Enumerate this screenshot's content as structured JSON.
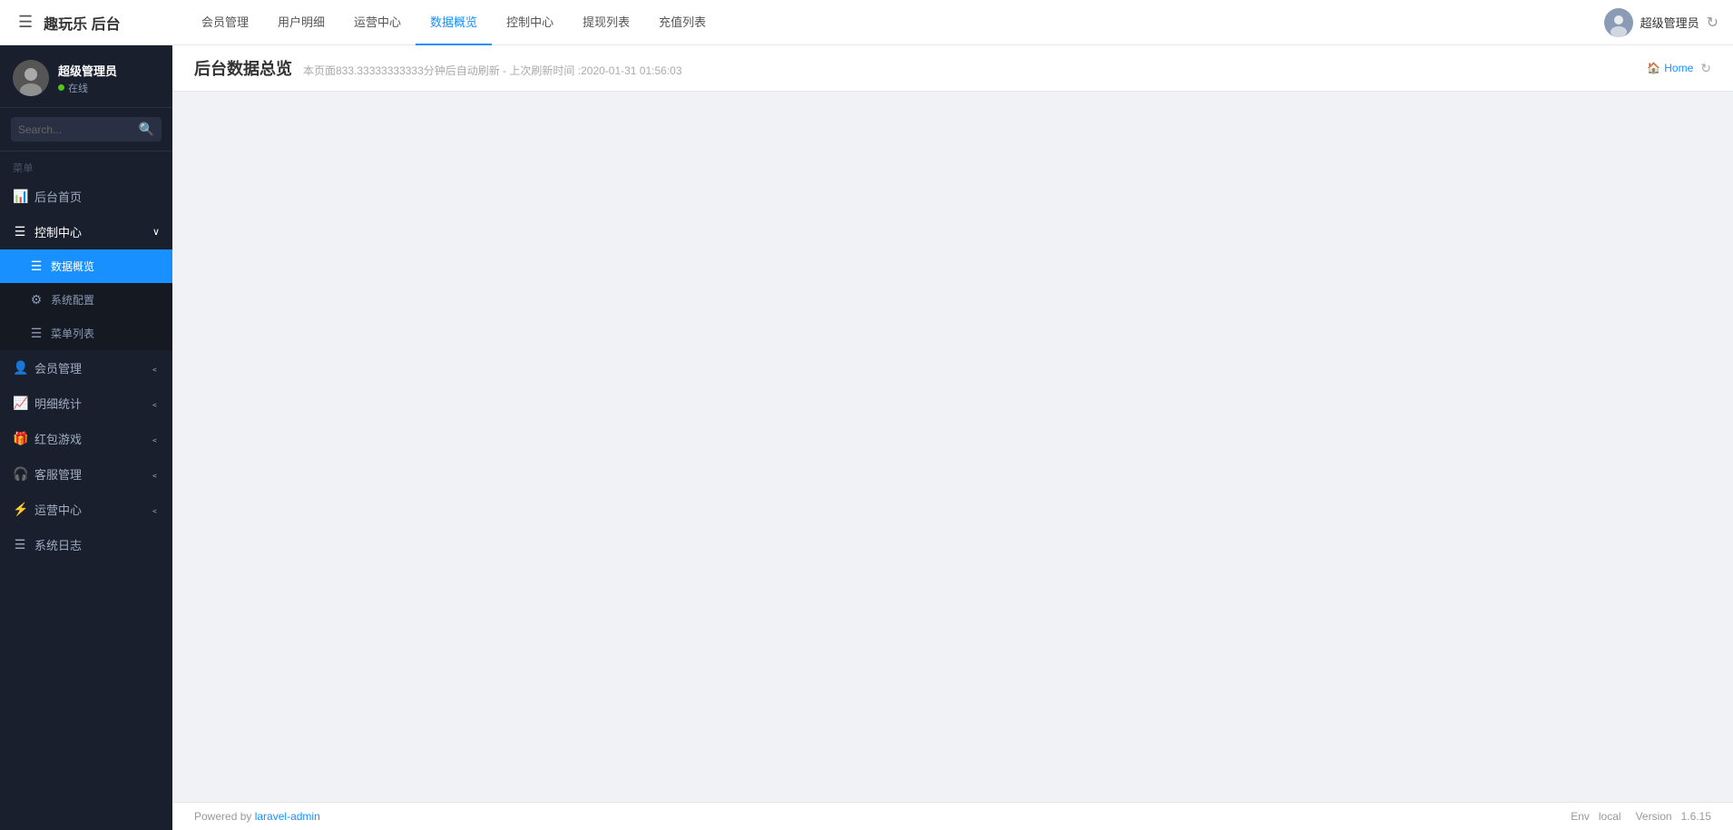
{
  "brand": {
    "title": "趣玩乐 后台"
  },
  "topnav": {
    "hamburger_label": "☰",
    "links": [
      {
        "id": "member-mgmt",
        "label": "会员管理",
        "active": false
      },
      {
        "id": "user-detail",
        "label": "用户明细",
        "active": false
      },
      {
        "id": "ops-center",
        "label": "运营中心",
        "active": false
      },
      {
        "id": "data-overview",
        "label": "数据概览",
        "active": true
      },
      {
        "id": "control-center",
        "label": "控制中心",
        "active": false
      },
      {
        "id": "withdrawal-list",
        "label": "提现列表",
        "active": false
      },
      {
        "id": "recharge-list",
        "label": "充值列表",
        "active": false
      }
    ],
    "user": {
      "name": "超级管理员"
    },
    "home_label": "Home"
  },
  "sidebar": {
    "user": {
      "name": "超级管理员",
      "status": "在线"
    },
    "search": {
      "placeholder": "Search..."
    },
    "section_label": "菜单",
    "items": [
      {
        "id": "dashboard",
        "label": "后台首页",
        "icon": "📊",
        "active": false,
        "has_arrow": false,
        "is_parent": false
      },
      {
        "id": "control-center",
        "label": "控制中心",
        "icon": "☰",
        "active": false,
        "has_arrow": true,
        "is_parent": true,
        "expanded": true,
        "children": [
          {
            "id": "data-overview-sub",
            "label": "数据概览",
            "icon": "☰",
            "active": true
          },
          {
            "id": "system-config",
            "label": "系统配置",
            "icon": "⚙",
            "active": false
          },
          {
            "id": "menu-list",
            "label": "菜单列表",
            "icon": "☰",
            "active": false
          }
        ]
      },
      {
        "id": "member-mgmt-side",
        "label": "会员管理",
        "icon": "👤",
        "active": false,
        "has_arrow": true,
        "is_parent": true,
        "expanded": false
      },
      {
        "id": "detail-stats",
        "label": "明细统计",
        "icon": "📈",
        "active": false,
        "has_arrow": true,
        "is_parent": true,
        "expanded": false
      },
      {
        "id": "red-packet-game",
        "label": "红包游戏",
        "icon": "🎁",
        "active": false,
        "has_arrow": true,
        "is_parent": true,
        "expanded": false
      },
      {
        "id": "customer-service",
        "label": "客服管理",
        "icon": "🎧",
        "active": false,
        "has_arrow": true,
        "is_parent": true,
        "expanded": false
      },
      {
        "id": "ops-center-side",
        "label": "运营中心",
        "icon": "⚡",
        "active": false,
        "has_arrow": true,
        "is_parent": true,
        "expanded": false
      },
      {
        "id": "system-log",
        "label": "系统日志",
        "icon": "☰",
        "active": false,
        "has_arrow": false,
        "is_parent": false
      }
    ]
  },
  "page": {
    "title": "后台数据总览",
    "subtitle": "本页面833.33333333333分钟后自动刷新 - 上次刷新时间 :2020-01-31 01:56:03",
    "home_label": "Home"
  },
  "footer": {
    "powered_by": "Powered by",
    "link_text": "laravel-admin",
    "env_label": "Env",
    "env_value": "local",
    "version_label": "Version",
    "version_value": "1.6.15"
  }
}
